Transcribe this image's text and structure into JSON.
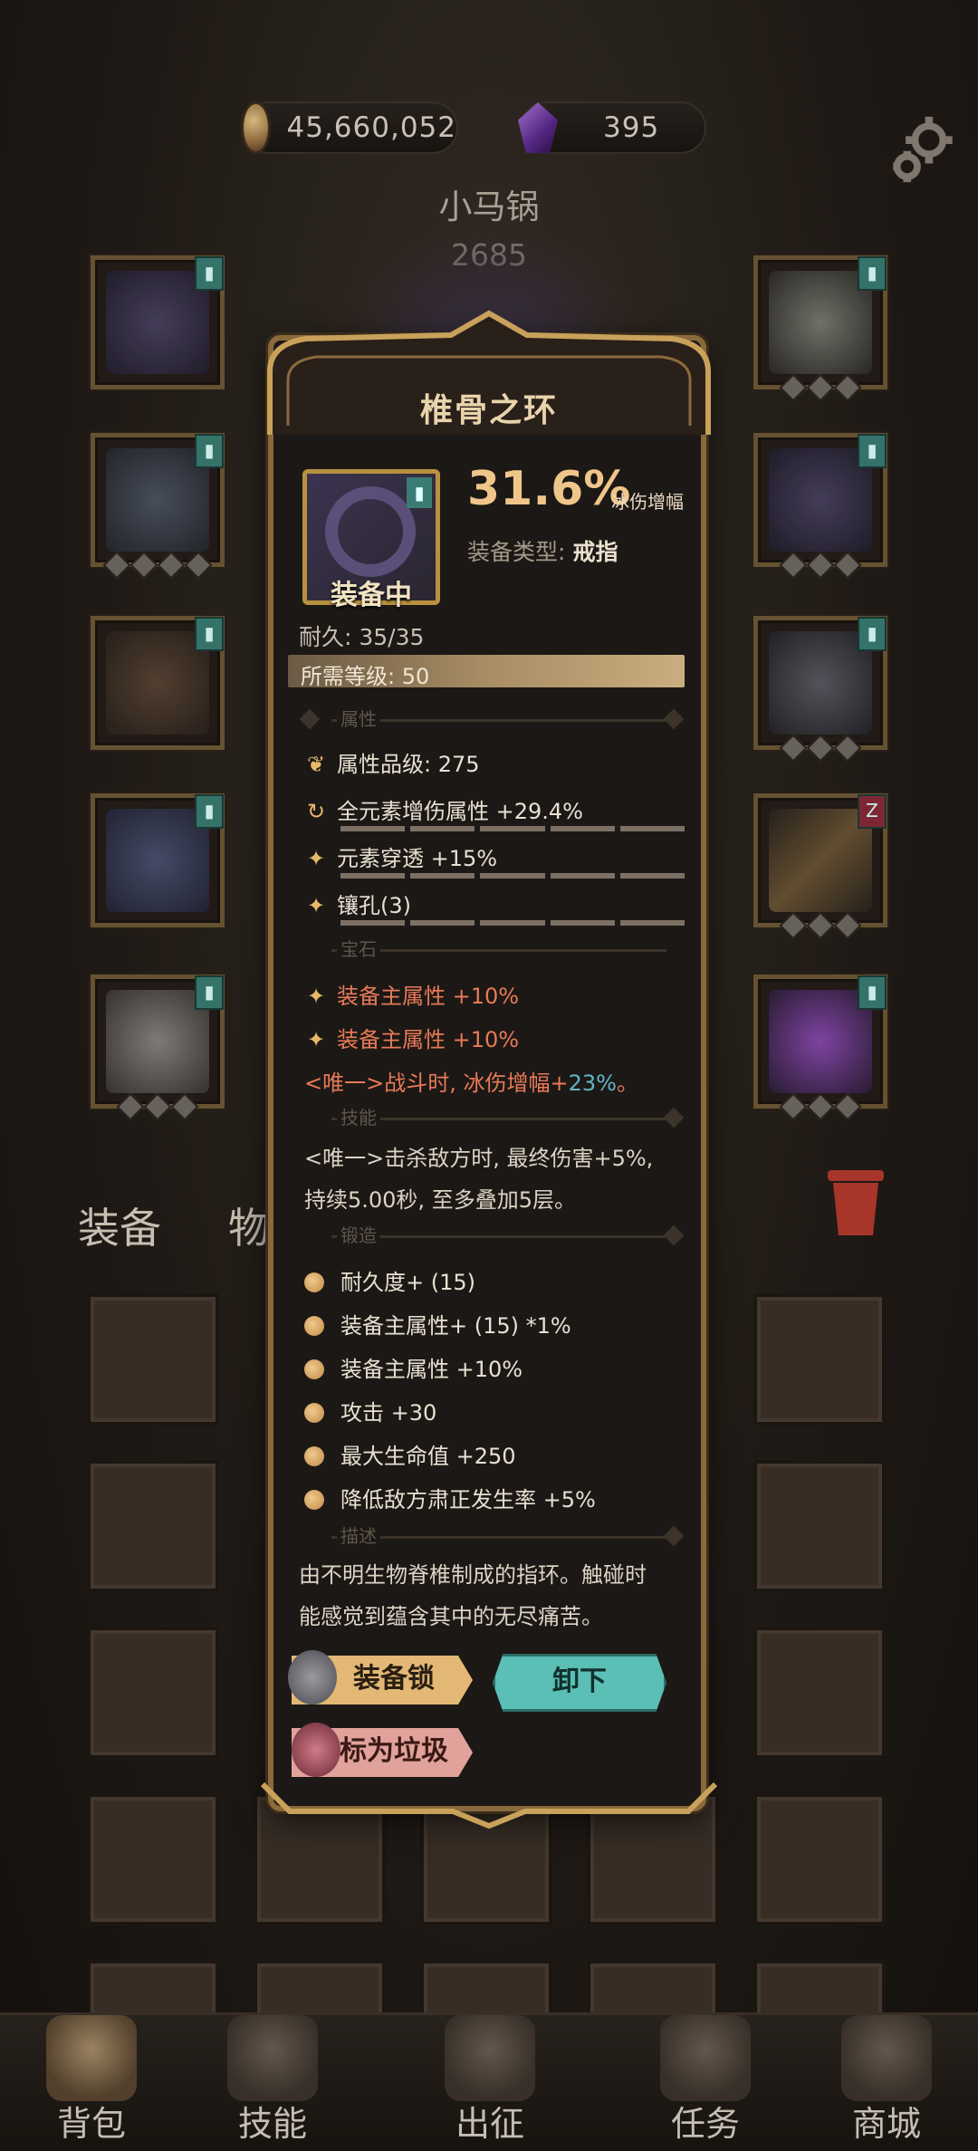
{
  "currency": {
    "gold": "45,660,052",
    "gems": "395"
  },
  "character": {
    "name": "小马锅",
    "score": "2685"
  },
  "equipment_tags": {
    "normal": "▮",
    "red": "Z"
  },
  "tabs": {
    "equipment": "装备",
    "items": "物品"
  },
  "popup": {
    "title": "椎骨之环",
    "main_value": "31.6%",
    "main_stat": "冰伤增幅",
    "type_label": "装备类型:",
    "type_value": "戒指",
    "equipped": "装备中",
    "durability": "耐久: 35/35",
    "required_level": "所需等级: 50",
    "sections": {
      "attributes": "属性",
      "gems": "宝石",
      "skills": "技能",
      "forging": "锻造",
      "description": "描述"
    },
    "attribute_rank": "属性品级: 275",
    "attributes": [
      "全元素增伤属性 +29.4%",
      "元素穿透 +15%",
      "镶孔(3)"
    ],
    "gems": [
      "装备主属性 +10%",
      "装备主属性 +10%"
    ],
    "unique_effect_prefix": "<唯一>战斗时, 冰伤增幅+",
    "unique_effect_value": "23%",
    "unique_effect_suffix": "。",
    "skill_text_line1": "<唯一>击杀敌方时, 最终伤害+5%,",
    "skill_text_line2": "持续5.00秒, 至多叠加5层。",
    "forging": [
      "耐久度+ (15)",
      "装备主属性+ (15) *1%",
      "装备主属性 +10%",
      "攻击 +30",
      "最大生命值 +250",
      "降低敌方肃正发生率 +5%"
    ],
    "description_line1": "由不明生物脊椎制成的指环。触碰时",
    "description_line2": "能感觉到蕴含其中的无尽痛苦。",
    "buttons": {
      "lock": "装备锁",
      "unequip": "卸下",
      "junk": "标为垃圾"
    }
  },
  "nav": [
    "背包",
    "技能",
    "出征",
    "任务",
    "商城"
  ],
  "colors": {
    "accent_gold": "#e3b874",
    "accent_teal": "#5bbfb6",
    "highlight_red": "#e77a58",
    "highlight_blue": "#5fb6c8"
  }
}
